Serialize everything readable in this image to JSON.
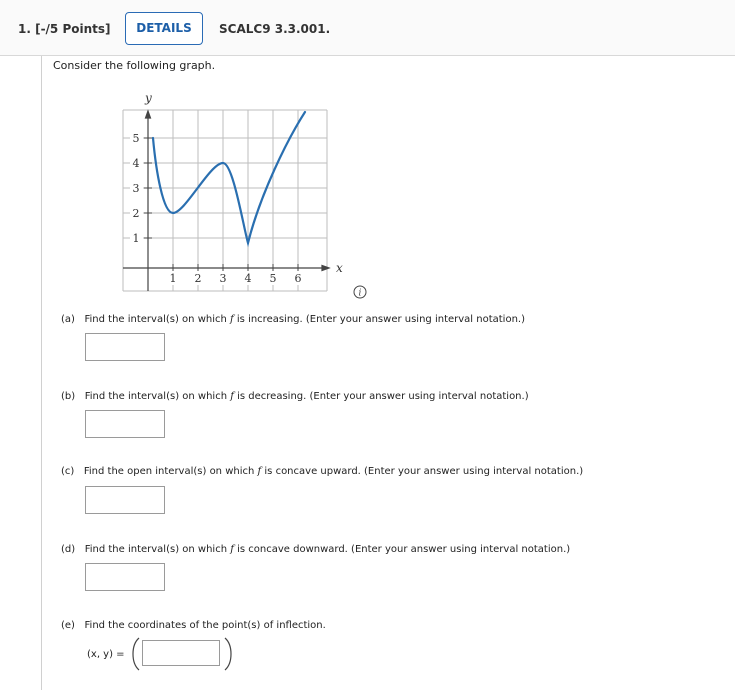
{
  "header": {
    "question_number": "1. [-/5 Points]",
    "details_label": "DETAILS",
    "question_code": "SCALC9 3.3.001."
  },
  "intro": "Consider the following graph.",
  "graph": {
    "y_axis_label": "y",
    "x_axis_label": "x",
    "x_ticks": [
      "1",
      "2",
      "3",
      "4",
      "5",
      "6"
    ],
    "y_ticks": [
      "1",
      "2",
      "3",
      "4",
      "5"
    ],
    "curve_color": "#2a6fb0",
    "curve_points": [
      [
        0.2,
        5.0
      ],
      [
        1.0,
        2.0
      ],
      [
        3.0,
        4.0
      ],
      [
        4.0,
        1.0
      ],
      [
        6.0,
        6.3
      ]
    ]
  },
  "info_icon": "info-icon",
  "parts": [
    {
      "prefix": "(a)",
      "before": "Find the interval(s) on which ",
      "var": "f",
      "after": " is increasing. (Enter your answer using interval notation.)",
      "value": ""
    },
    {
      "prefix": "(b)",
      "before": "Find the interval(s) on which ",
      "var": "f",
      "after": " is decreasing. (Enter your answer using interval notation.)",
      "value": ""
    },
    {
      "prefix": "(c)",
      "before": "Find the open interval(s) on which ",
      "var": "f",
      "after": " is concave upward. (Enter your answer using interval notation.)",
      "value": ""
    },
    {
      "prefix": "(d)",
      "before": "Find the interval(s) on which ",
      "var": "f",
      "after": " is concave downward. (Enter your answer using interval notation.)",
      "value": ""
    },
    {
      "prefix": "(e)",
      "before": "Find the coordinates of the point(s) of inflection.",
      "var": "",
      "after": "",
      "value": ""
    }
  ],
  "inflection": {
    "label": "(x, y)  =",
    "value": ""
  }
}
